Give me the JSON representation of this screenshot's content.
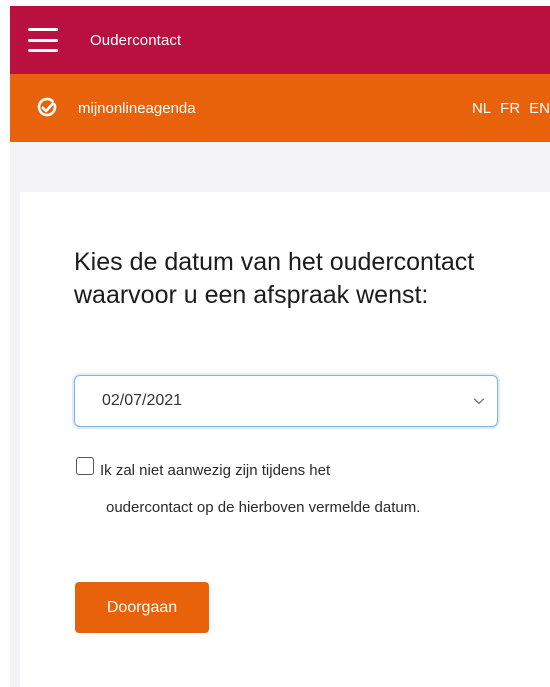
{
  "topbar": {
    "menu_icon": "hamburger-menu-icon",
    "title": "Oudercontact",
    "color": "#b9103f"
  },
  "brandbar": {
    "logo_icon": "check-circle-icon",
    "brand_name": "mijnonlineagenda",
    "color": "#e8620c",
    "languages": [
      "NL",
      "FR",
      "EN"
    ]
  },
  "form": {
    "heading": "Kies de datum van het oudercontact waarvoor u een afspraak wenst:",
    "date_select": {
      "selected_value": "02/07/2021"
    },
    "absence_checkbox": {
      "checked": false,
      "label_line1": "Ik zal niet aanwezig zijn tijdens het",
      "label_rest": "oudercontact op de hierboven vermelde datum."
    },
    "submit_label": "Doorgaan"
  }
}
